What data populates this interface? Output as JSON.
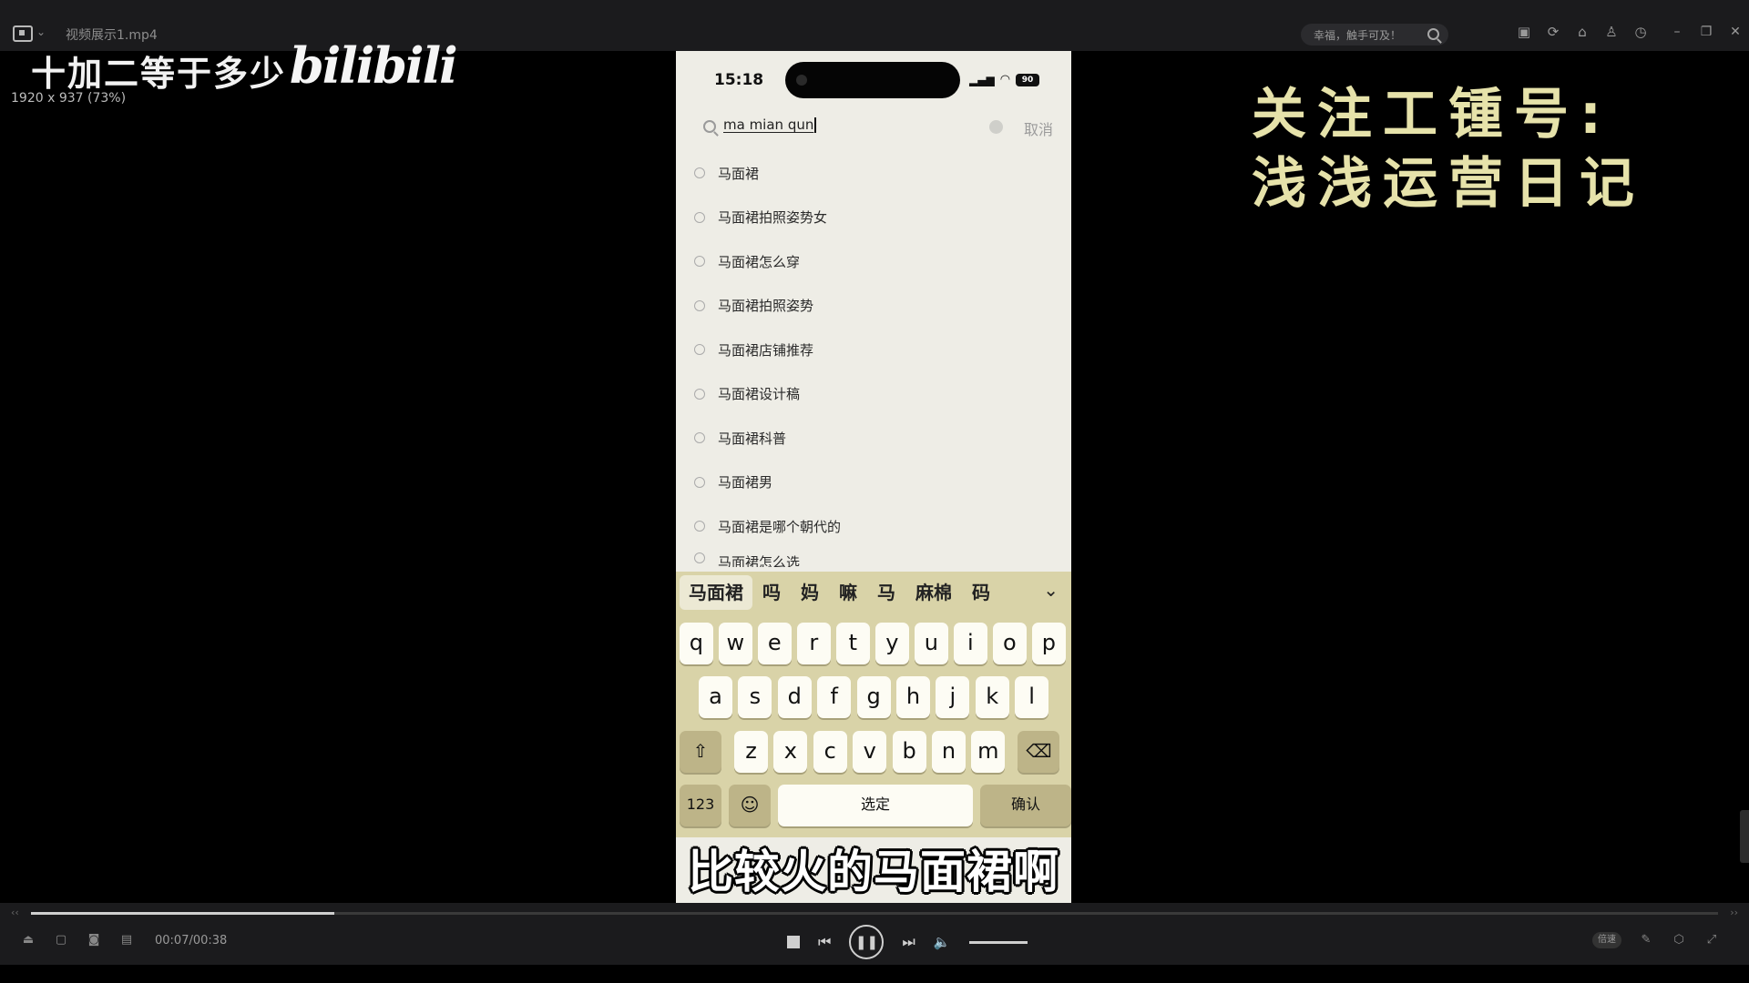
{
  "player": {
    "file_title": "视频展示1.mp4",
    "search_placeholder": "幸福，触手可及！",
    "video_dims": "1920 x 937 (73%)",
    "time": "00:07/00:38",
    "progress": 0.18,
    "speed_label": "倍速"
  },
  "overlay": {
    "question": "十加二等于多少",
    "logo_text": "bilibili",
    "promo_line1": "关注工锺号:",
    "promo_line2": "浅浅运营日记",
    "subtitle": "比较火的马面裙啊"
  },
  "phone": {
    "time": "15:18",
    "battery": "90",
    "search_text": "ma mian qun",
    "cancel_label": "取消",
    "suggestions": [
      "马面裙",
      "马面裙拍照姿势女",
      "马面裙怎么穿",
      "马面裙拍照姿势",
      "马面裙店铺推荐",
      "马面裙设计稿",
      "马面裙科普",
      "马面裙男",
      "马面裙是哪个朝代的",
      "马面裙怎么选"
    ],
    "candidates": [
      "马面裙",
      "吗",
      "妈",
      "嘛",
      "马",
      "麻棉",
      "码"
    ],
    "keys_row1": [
      "q",
      "w",
      "e",
      "r",
      "t",
      "y",
      "u",
      "i",
      "o",
      "p"
    ],
    "keys_row2": [
      "a",
      "s",
      "d",
      "f",
      "g",
      "h",
      "j",
      "k",
      "l"
    ],
    "keys_row3": [
      "z",
      "x",
      "c",
      "v",
      "b",
      "n",
      "m"
    ],
    "key_123": "123",
    "key_space": "选定",
    "key_confirm": "确认"
  },
  "icons": {
    "shift": "shift-icon",
    "delete": "delete-icon",
    "emoji": "emoji-icon"
  },
  "colors": {
    "promo": "#e6e2aa",
    "keyboard_bg": "#d9d3a8",
    "phone_bg": "#eeede6"
  }
}
